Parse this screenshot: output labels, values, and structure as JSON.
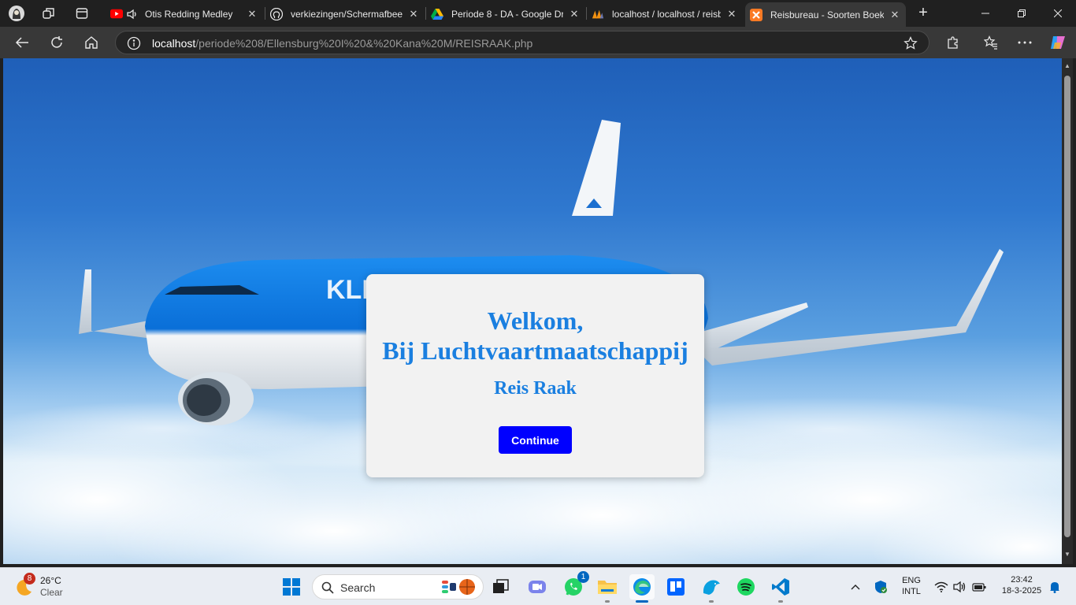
{
  "browser": {
    "tabs": [
      {
        "title": "Otis Redding Medley",
        "icon": "youtube-icon"
      },
      {
        "title": "verkiezingen/Schermafbeel",
        "icon": "github-icon"
      },
      {
        "title": "Periode 8 - DA - Google Dr",
        "icon": "google-drive-icon"
      },
      {
        "title": "localhost / localhost / reisb",
        "icon": "phpmyadmin-icon"
      },
      {
        "title": "Reisbureau - Soorten Boek",
        "icon": "xampp-icon",
        "active": true
      }
    ],
    "url_host": "localhost",
    "url_path": "/periode%208/Ellensburg%20I%20&%20Kana%20M/REISRAAK.php"
  },
  "page": {
    "welcome_line1": "Welkom,",
    "welcome_line2": "Bij Luchtvaartmaatschappij",
    "company": "Reis Raak",
    "continue_label": "Continue",
    "accent_color": "#1a7fe0",
    "button_color": "#0000ff"
  },
  "taskbar": {
    "weather_temp": "26°C",
    "weather_cond": "Clear",
    "weather_badge": "8",
    "search_label": "Search",
    "whatsapp_badge": "1",
    "lang_top": "ENG",
    "lang_bottom": "INTL",
    "time": "23:42",
    "date": "18-3-2025"
  }
}
